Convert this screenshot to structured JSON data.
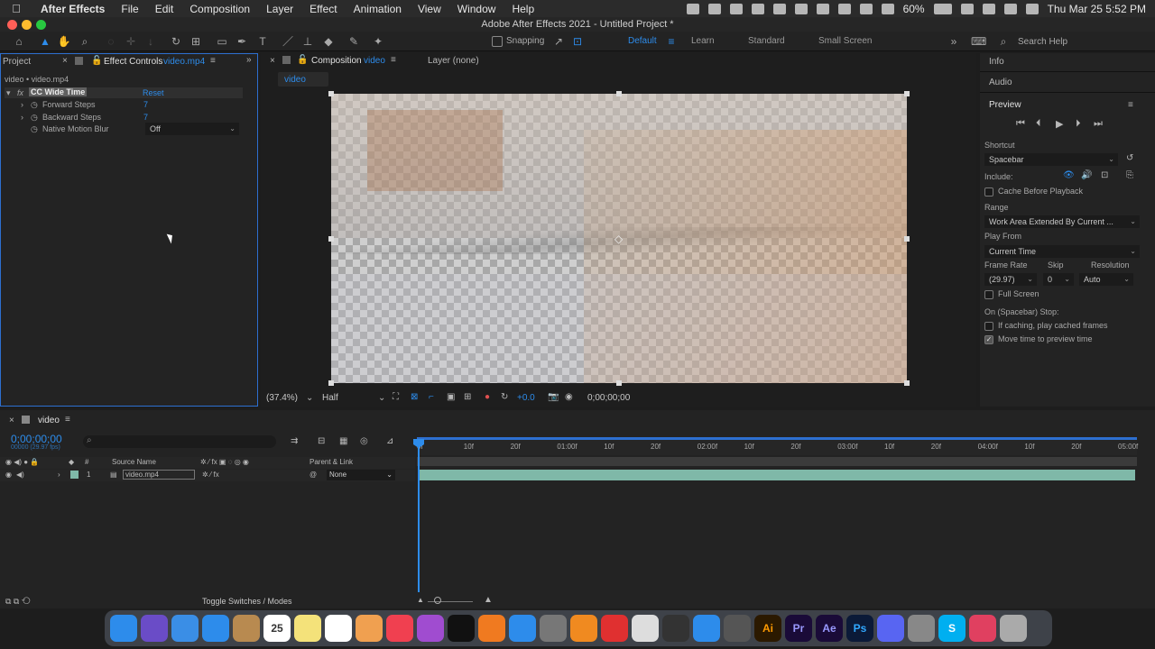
{
  "menubar": {
    "app": "After Effects",
    "items": [
      "File",
      "Edit",
      "Composition",
      "Layer",
      "Effect",
      "Animation",
      "View",
      "Window",
      "Help"
    ],
    "battery": "60%",
    "datetime": "Thu Mar 25  5:52 PM"
  },
  "window": {
    "title": "Adobe After Effects 2021 - Untitled Project *"
  },
  "toolbar": {
    "snapping": "Snapping",
    "workspaces": [
      "Default",
      "Learn",
      "Standard",
      "Small Screen"
    ],
    "active_workspace": "Default",
    "search_placeholder": "Search Help"
  },
  "project_panel": {
    "tab_project": "Project",
    "tab_effect_controls": "Effect Controls",
    "effect_layer": "video.mp4",
    "breadcrumb": "video • video.mp4",
    "effect_name": "CC Wide Time",
    "reset": "Reset",
    "params": [
      {
        "name": "Forward Steps",
        "value": "7"
      },
      {
        "name": "Backward Steps",
        "value": "7"
      },
      {
        "name": "Native Motion Blur",
        "value": "Off"
      }
    ]
  },
  "comp_panel": {
    "tab_composition": "Composition",
    "comp_name": "video",
    "tab_layer": "Layer (none)",
    "sub_tab": "video",
    "zoom": "(37.4%)",
    "resolution": "Half",
    "exposure": "+0.0",
    "timecode": "0;00;00;00"
  },
  "right_panel": {
    "info": "Info",
    "audio": "Audio",
    "preview": "Preview",
    "shortcut_label": "Shortcut",
    "shortcut_value": "Spacebar",
    "include_label": "Include:",
    "cache_before": "Cache Before Playback",
    "range_label": "Range",
    "range_value": "Work Area Extended By Current ...",
    "play_from_label": "Play From",
    "play_from_value": "Current Time",
    "frame_rate_label": "Frame Rate",
    "skip_label": "Skip",
    "resolution_label": "Resolution",
    "frame_rate_value": "(29.97)",
    "skip_value": "0",
    "resolution_value": "Auto",
    "full_screen": "Full Screen",
    "on_stop": "On (Spacebar) Stop:",
    "if_caching": "If caching, play cached frames",
    "move_time": "Move time to preview time"
  },
  "timeline": {
    "tab": "video",
    "timecode": "0;00;00;00",
    "frames": "00000 (29.97 fps)",
    "col_num": "#",
    "col_source": "Source Name",
    "col_parent": "Parent & Link",
    "layer_num": "1",
    "layer_name": "video.mp4",
    "parent_value": "None",
    "ruler": [
      "0f",
      "10f",
      "20f",
      "01:00f",
      "10f",
      "20f",
      "02:00f",
      "10f",
      "20f",
      "03:00f",
      "10f",
      "20f",
      "04:00f",
      "10f",
      "20f",
      "05:00f"
    ],
    "toggle": "Toggle Switches / Modes"
  },
  "dock": {
    "icons": [
      "finder-icon",
      "siri-icon",
      "mail-icon",
      "safari-icon",
      "archive-icon",
      "calendar-icon",
      "notes-icon",
      "reminders-icon",
      "photos-icon",
      "music-icon",
      "podcasts-icon",
      "tv-icon",
      "books-icon",
      "appstore-icon",
      "system-prefs-icon",
      "vlc-icon",
      "cast-icon",
      "chrome-icon",
      "inkscape-icon",
      "arrow-app-icon",
      "discord-bus-icon",
      "illustrator-icon",
      "premiere-icon",
      "aftereffects-icon",
      "photoshop-icon",
      "discord-icon",
      "automator-icon",
      "skype-icon",
      "lips-icon",
      "trash-icon"
    ],
    "calendar_day": "25",
    "labels": {
      "ai": "Ai",
      "pr": "Pr",
      "ae": "Ae",
      "ps": "Ps",
      "s": "S"
    }
  }
}
